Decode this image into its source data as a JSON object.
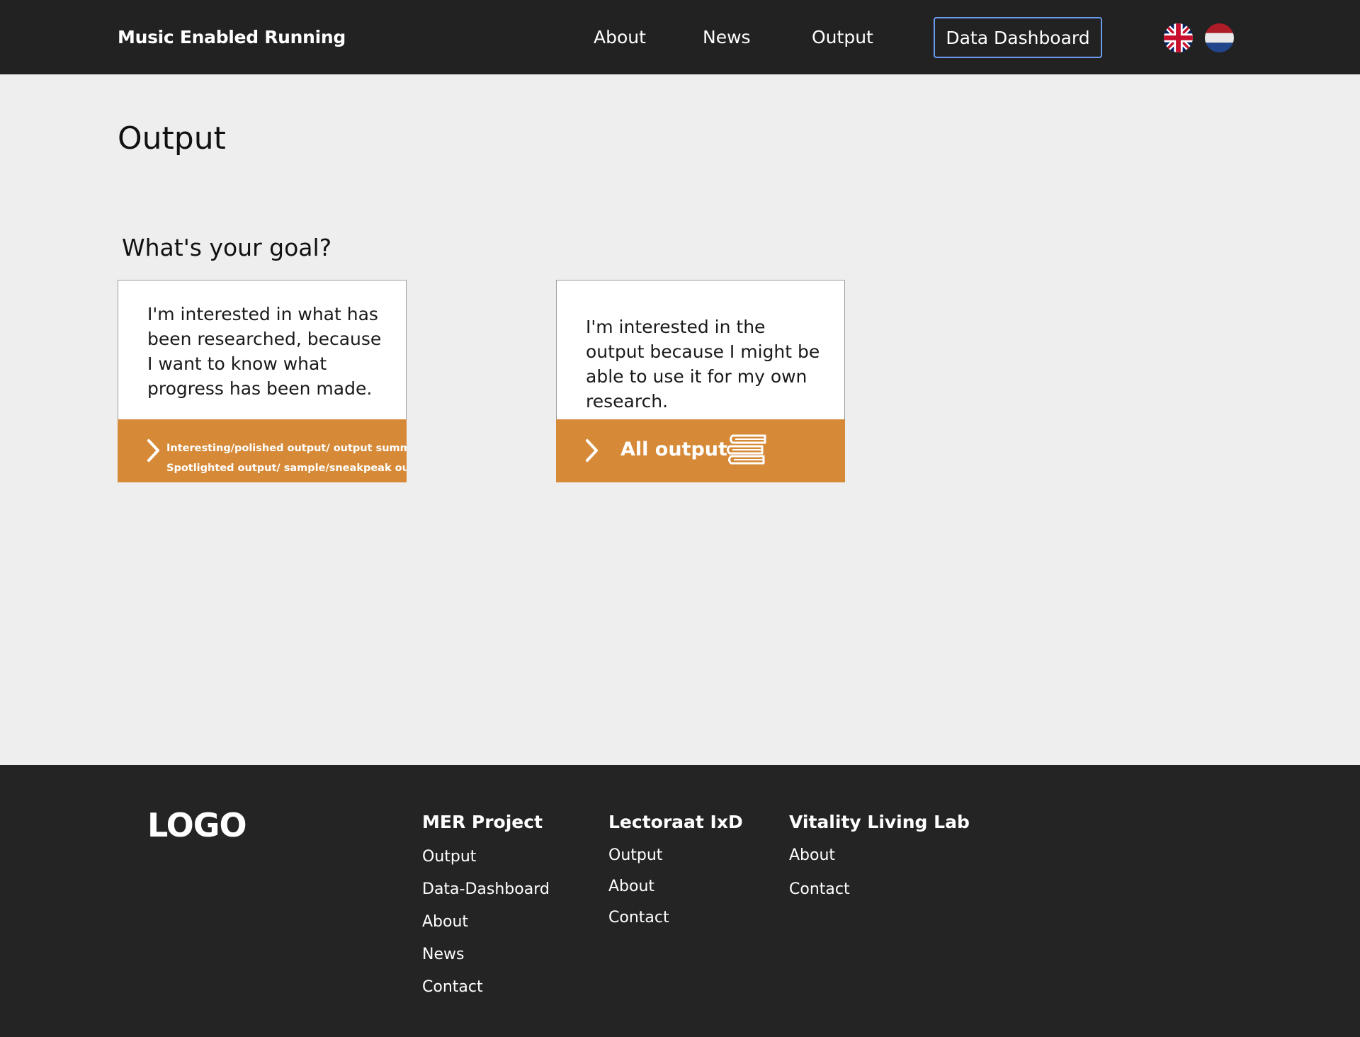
{
  "header": {
    "brand": "Music Enabled Running",
    "nav": {
      "about": "About",
      "news": "News",
      "output": "Output",
      "dashboard": "Data Dashboard"
    },
    "languages": [
      "flag-uk-icon",
      "flag-nl-icon"
    ]
  },
  "main": {
    "title": "Output",
    "goal_heading": "What's your goal?",
    "cards": [
      {
        "text": "I'm interested in what has been researched, because I want to know what progress has been made.",
        "bar_lines": [
          "Interesting/polished output/ output summary",
          "Spotlighted output/ sample/sneakpeak output"
        ],
        "icon": "chevron-right-icon"
      },
      {
        "text": "I'm interested in the output because I might be able to use it for my own research.",
        "bar_label": "All output",
        "icon": "books-icon"
      }
    ]
  },
  "footer": {
    "logo": "LOGO",
    "columns": [
      {
        "heading": "MER Project",
        "links": [
          "Output",
          "Data-Dashboard",
          "About",
          "News",
          "Contact"
        ]
      },
      {
        "heading": "Lectoraat IxD",
        "links": [
          "Output",
          "About",
          "Contact"
        ]
      },
      {
        "heading": "Vitality Living Lab",
        "links": [
          "About",
          "Contact"
        ]
      }
    ]
  },
  "colors": {
    "header_bg": "#222222",
    "page_bg": "#eeeeee",
    "accent": "#d68a38",
    "dashboard_border": "#6a9cf0",
    "footer_bg": "#242424"
  }
}
